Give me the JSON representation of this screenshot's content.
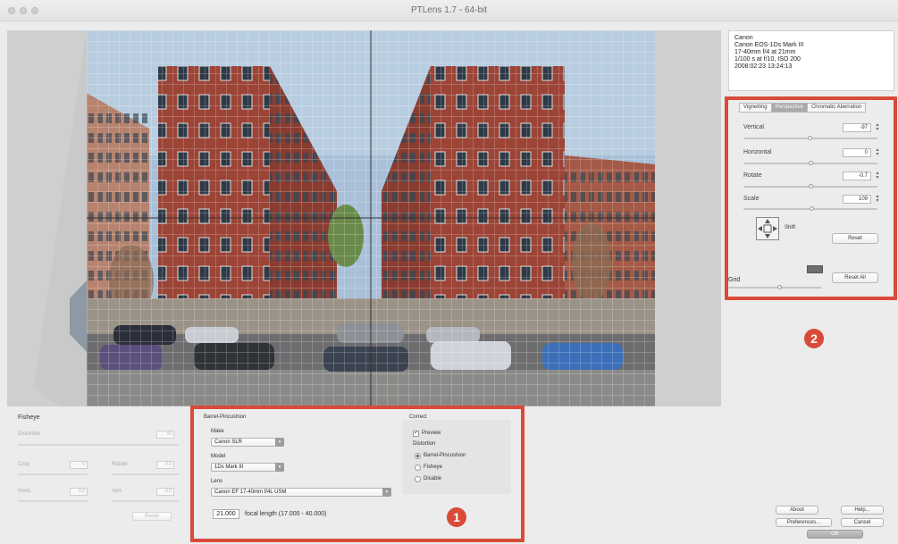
{
  "window": {
    "title": "PTLens 1.7 - 64-bit"
  },
  "exif": {
    "lines": [
      "Canon",
      "Canon EOS-1Ds Mark III",
      "17-40mm f/4 at 21mm",
      "1/100 s at f/10, ISO 200",
      "2008:02:23 13:24:13"
    ]
  },
  "tabs": [
    {
      "label": "Vignetting",
      "active": false
    },
    {
      "label": "Perspective",
      "active": true
    },
    {
      "label": "Chromatic Aberration",
      "active": false
    }
  ],
  "perspective": {
    "vertical": {
      "label": "Vertical",
      "value": "-97"
    },
    "horizontal": {
      "label": "Horizontal",
      "value": "0"
    },
    "rotate": {
      "label": "Rotate",
      "value": "-0.7"
    },
    "scale": {
      "label": "Scale",
      "value": "109"
    },
    "shift_label": "Shift",
    "reset_label": "Reset",
    "grid_label": "Grid",
    "reset_all_label": "Reset All"
  },
  "badges": {
    "one": "1",
    "two": "2"
  },
  "fisheye": {
    "title": "Fisheye",
    "distortion_label": "Distortion",
    "distortion_value": "50",
    "crop_label": "Crop",
    "crop_value": "0",
    "rotate_label": "Rotate",
    "rotate_value": "0.0",
    "horiz_label": "Horiz.",
    "horiz_value": "0.0",
    "vert_label": "Vert.",
    "vert_value": "0.0",
    "reset_label": "Reset"
  },
  "barrel": {
    "title": "Barrel-Pincushion",
    "make_label": "Make",
    "make_value": "Canon SLR",
    "model_label": "Model",
    "model_value": "1Ds Mark III",
    "lens_label": "Lens",
    "lens_value": "Canon EF 17-40mm f/4L USM",
    "focal_value": "21.000",
    "focal_text": "focal length (17.000 - 40.000)"
  },
  "correct": {
    "title": "Correct",
    "preview_label": "Preview",
    "preview_checked": true,
    "distortion_label": "Distortion",
    "options": [
      {
        "label": "Barrel-Pincushion",
        "selected": true
      },
      {
        "label": "Fisheye",
        "selected": false
      },
      {
        "label": "Disable",
        "selected": false
      }
    ]
  },
  "footer_buttons": {
    "about": "About",
    "help": "Help...",
    "preferences": "Preferences...",
    "cancel": "Cancel",
    "ok": "OK"
  },
  "colors": {
    "highlight": "#d94a38",
    "brick": "#9c4436",
    "sky": "#9fb6cf"
  }
}
